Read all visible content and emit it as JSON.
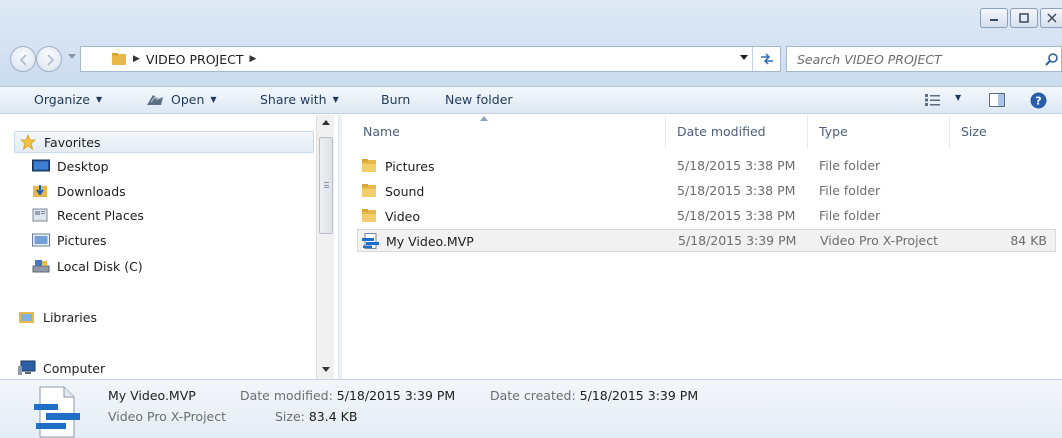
{
  "address": {
    "path": "VIDEO PROJECT",
    "search_placeholder": "Search VIDEO PROJECT"
  },
  "toolbar": {
    "organize": "Organize",
    "open": "Open",
    "share_with": "Share with",
    "burn": "Burn",
    "new_folder": "New folder"
  },
  "nav": {
    "favorites": "Favorites",
    "desktop": "Desktop",
    "downloads": "Downloads",
    "recent_places": "Recent Places",
    "pictures": "Pictures",
    "local_disk": "Local Disk (C)",
    "libraries": "Libraries",
    "computer": "Computer"
  },
  "columns": {
    "name": "Name",
    "date_modified": "Date modified",
    "type": "Type",
    "size": "Size"
  },
  "files": [
    {
      "name": "Pictures",
      "date": "5/18/2015 3:38 PM",
      "type": "File folder",
      "size": "",
      "icon": "folder-icon"
    },
    {
      "name": "Sound",
      "date": "5/18/2015 3:38 PM",
      "type": "File folder",
      "size": "",
      "icon": "folder-icon"
    },
    {
      "name": "Video",
      "date": "5/18/2015 3:38 PM",
      "type": "File folder",
      "size": "",
      "icon": "folder-icon"
    },
    {
      "name": "My Video.MVP",
      "date": "5/18/2015 3:39 PM",
      "type": "Video Pro X-Project",
      "size": "84 KB",
      "icon": "project-file-icon"
    }
  ],
  "details": {
    "name": "My Video.MVP",
    "type": "Video Pro X-Project",
    "modified_label": "Date modified:",
    "modified_value": "5/18/2015 3:39 PM",
    "size_label": "Size:",
    "size_value": "83.4 KB",
    "created_label": "Date created:",
    "created_value": "5/18/2015 3:39 PM"
  },
  "colors": {
    "folder": "#e8b84a",
    "accent": "#1e395b",
    "project_blue": "#1f6fc7"
  }
}
